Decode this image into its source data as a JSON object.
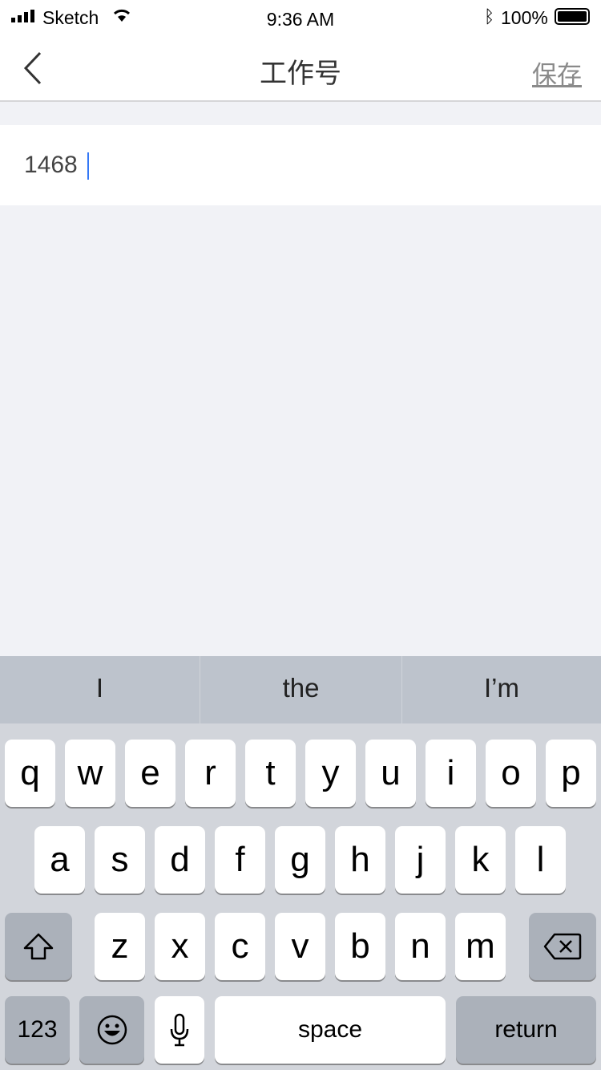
{
  "status": {
    "carrier": "Sketch",
    "time": "9:36 AM",
    "battery": "100%"
  },
  "nav": {
    "title": "工作号",
    "save": "保存"
  },
  "field": {
    "value": "1468"
  },
  "suggestions": [
    "I",
    "the",
    "I’m"
  ],
  "keyboard": {
    "row1": [
      "q",
      "w",
      "e",
      "r",
      "t",
      "y",
      "u",
      "i",
      "o",
      "p"
    ],
    "row2": [
      "a",
      "s",
      "d",
      "f",
      "g",
      "h",
      "j",
      "k",
      "l"
    ],
    "row3": [
      "z",
      "x",
      "c",
      "v",
      "b",
      "n",
      "m"
    ],
    "numbers": "123",
    "space": "space",
    "return": "return"
  }
}
